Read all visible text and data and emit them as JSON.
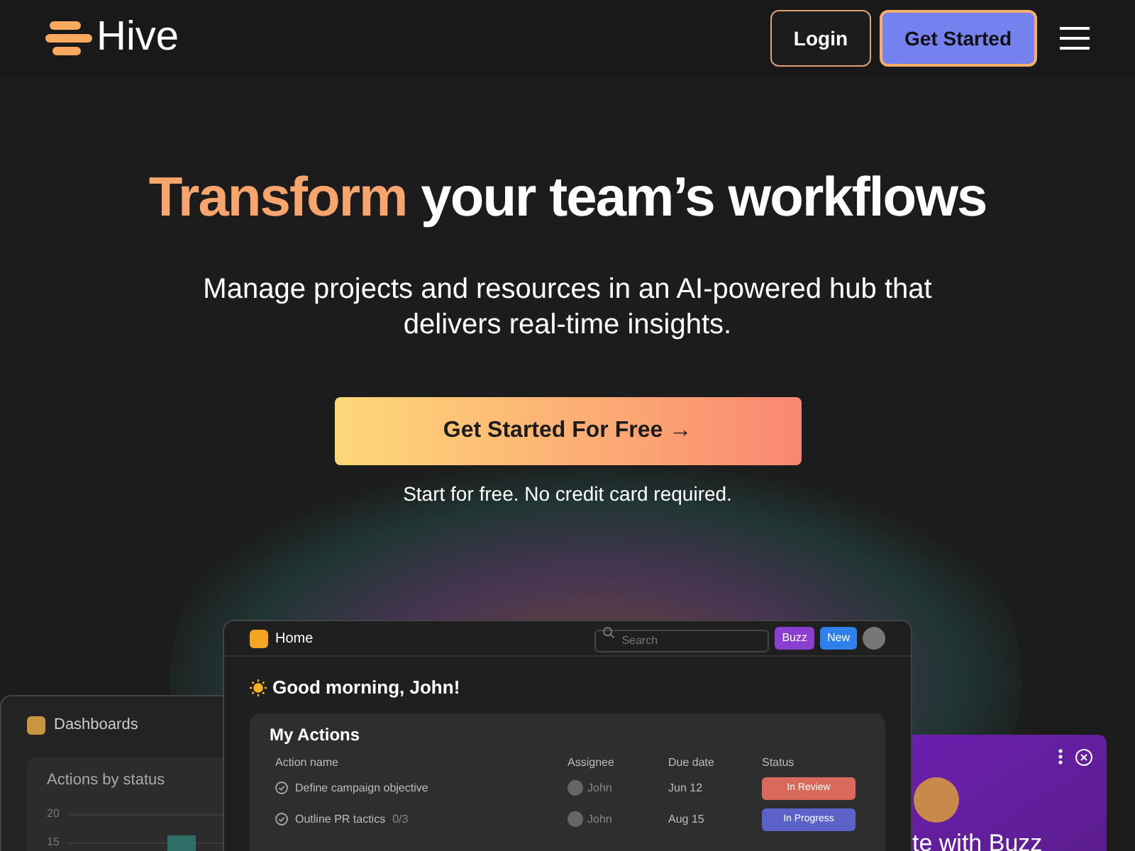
{
  "header": {
    "logo": "Hive",
    "buttons": [
      {
        "label": "Login",
        "kind": "outline"
      },
      {
        "label": "Get Started",
        "kind": "filled"
      }
    ]
  },
  "hero": {
    "title_highlight": "Transform",
    "title_rest": "your team’s workflows",
    "subtitle": "Manage projects and resources in an AI-powered hub that delivers real-time insights.",
    "cta": "Get Started For Free →",
    "note": "Start for free. No credit card required."
  },
  "dashboards_window": {
    "title": "Dashboards",
    "card_title": "Actions by status",
    "axis_labels": [
      "20",
      "15"
    ]
  },
  "home_window": {
    "title": "Home",
    "search_placeholder": "Search",
    "buzz_button": "Buzz",
    "new_button": "New",
    "greeting": "Good morning, John!",
    "actions_title": "My Actions",
    "columns": [
      "Action name",
      "Assignee",
      "Due date",
      "Status"
    ],
    "rows": [
      {
        "name": "Define campaign objective",
        "extra": "",
        "assignee": "John",
        "due": "Jun 12",
        "status": "In Review",
        "color": "#d9695b"
      },
      {
        "name": "Outline PR tactics",
        "extra": "0/3",
        "assignee": "John",
        "due": "Aug 15",
        "status": "In Progress",
        "color": "#5b63c9"
      }
    ]
  },
  "buzz_panel": {
    "text": "te with Buzz"
  }
}
